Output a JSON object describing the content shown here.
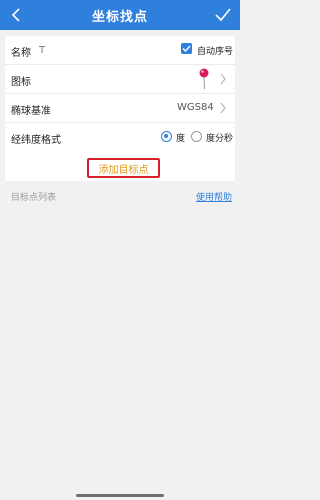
{
  "header": {
    "title": "坐标找点",
    "back_icon": "chevron-left-icon",
    "confirm_icon": "check-icon",
    "background": "#2f7fdc"
  },
  "form": {
    "name": {
      "label": "名称",
      "placeholder": "T",
      "value": "",
      "auto_number_label": "自动序号",
      "auto_number_checked": true
    },
    "icon": {
      "label": "图标",
      "icon": "map-pin-icon"
    },
    "datum": {
      "label": "椭球基准",
      "value": "WGS84"
    },
    "format": {
      "label": "经纬度格式",
      "options": [
        {
          "label": "度",
          "selected": true
        },
        {
          "label": "度分秒",
          "selected": false
        }
      ]
    }
  },
  "add_button": {
    "label": "添加目标点",
    "text_color": "#e19a1a",
    "border_color": "#d9202a"
  },
  "list_section": {
    "label": "目标点列表",
    "help_link": "使用帮助"
  }
}
